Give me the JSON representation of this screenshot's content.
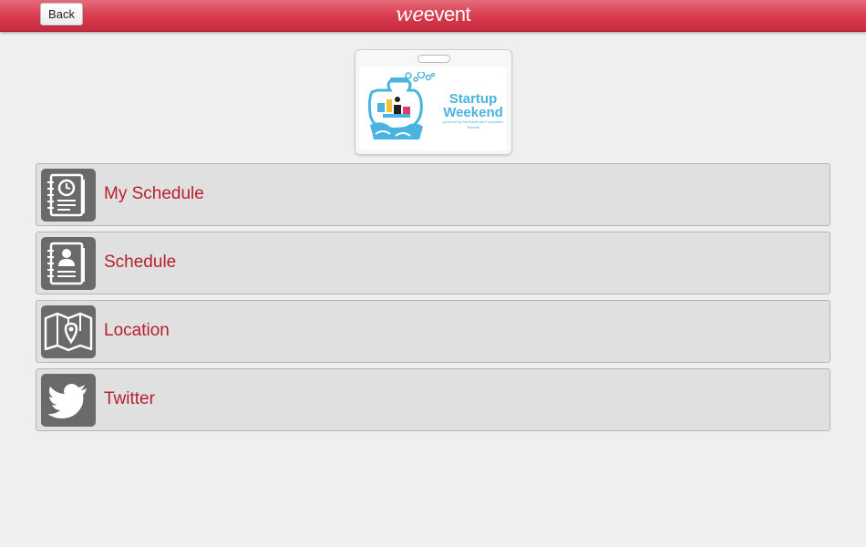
{
  "header": {
    "back_label": "Back",
    "brand_we": "we",
    "brand_event": "event",
    "accent_color": "#d73a4d"
  },
  "event_badge": {
    "logo_line1": "Startup",
    "logo_line2": "Weekend",
    "logo_subline": "powered by the Kauffman Foundation",
    "logo_city": "Tenerife",
    "logo_color": "#4bb3e0"
  },
  "menu": {
    "items": [
      {
        "label": "My Schedule",
        "icon": "clock-document-icon"
      },
      {
        "label": "Schedule",
        "icon": "person-document-icon"
      },
      {
        "label": "Location",
        "icon": "map-pin-icon"
      },
      {
        "label": "Twitter",
        "icon": "twitter-bird-icon"
      }
    ],
    "label_color": "#b81f2e",
    "icon_bg": "#6a6a6a"
  }
}
